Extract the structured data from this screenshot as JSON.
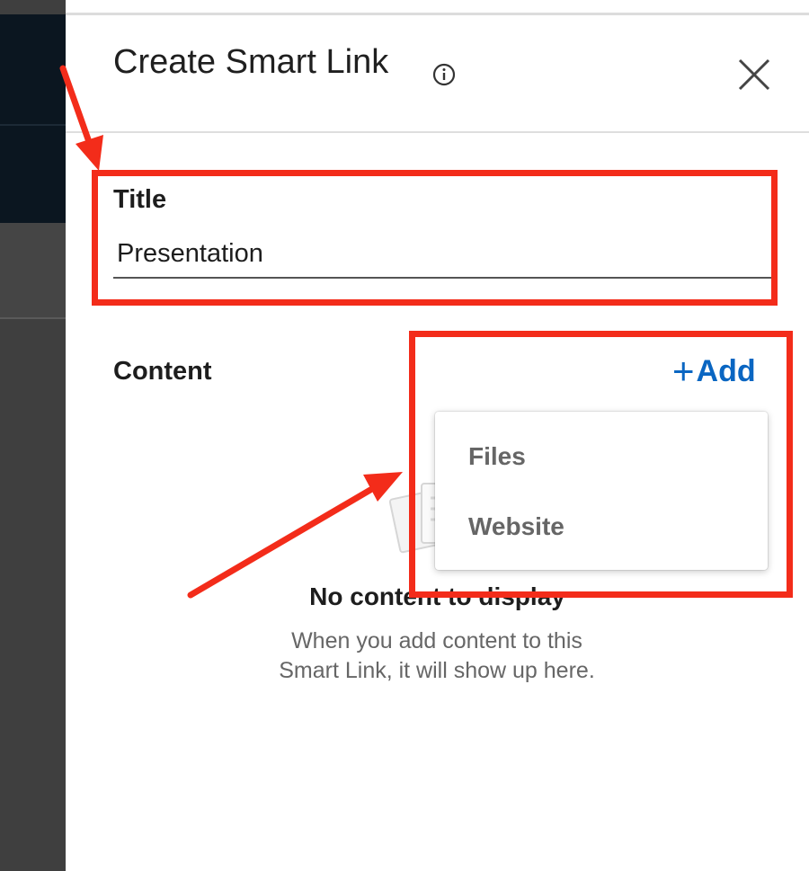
{
  "panel": {
    "title": "Create Smart Link"
  },
  "form": {
    "title_label": "Title",
    "title_value": "Presentation",
    "content_label": "Content",
    "add_label": "Add",
    "add_plus": "+"
  },
  "dropdown": {
    "items": [
      {
        "label": "Files"
      },
      {
        "label": "Website"
      }
    ]
  },
  "empty_state": {
    "title": "No content to display",
    "line1": "When you add content to this",
    "line2": "Smart Link, it will show up here."
  },
  "colors": {
    "accent": "#0a66c2",
    "annotation": "#f32c1a",
    "sidebar_dark": "#0b1620",
    "sidebar_gray": "#3f3f3f"
  },
  "icons": {
    "info": "info-icon",
    "close": "close-icon"
  }
}
